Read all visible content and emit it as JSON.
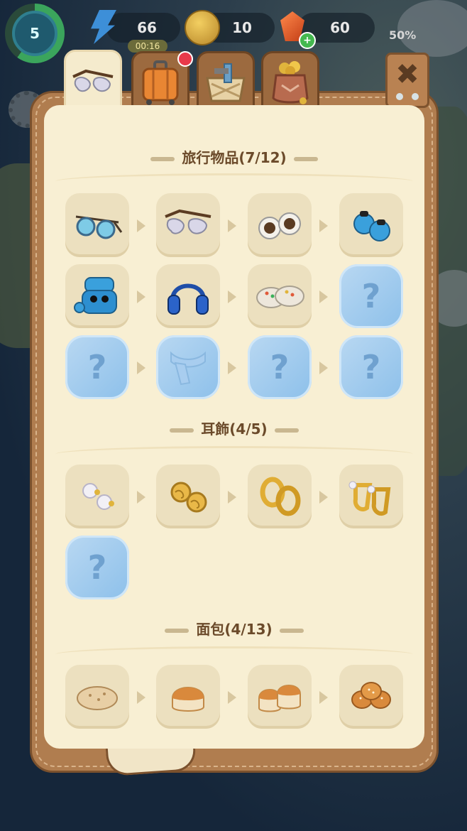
{
  "hud": {
    "level": "5",
    "energy": "66",
    "energy_timer": "00:16",
    "coins": "10",
    "gems": "60",
    "gem_plus": "+",
    "percent": "50%"
  },
  "tabs": [
    {
      "name": "sunglasses-tab-icon",
      "active": true
    },
    {
      "name": "suitcase-tab-icon",
      "active": false,
      "badge": true
    },
    {
      "name": "toolbox-tab-icon",
      "active": false
    },
    {
      "name": "treasure-pot-tab-icon",
      "active": false
    }
  ],
  "close_label": "✖",
  "sections": [
    {
      "title": "旅行物品(7/12)",
      "items": [
        "blue-sunglasses-icon",
        "heart-sunglasses-icon",
        "white-goggles-icon",
        "blue-earbuds-icon",
        "earbuds-case-icon",
        "headphones-icon",
        "clogs-icon",
        "locked",
        "locked",
        "scarf-silhouette-locked",
        "locked",
        "locked"
      ]
    },
    {
      "title": "耳飾(4/5)",
      "items": [
        "pearl-earrings-icon",
        "knot-earrings-icon",
        "gold-hoop-earrings-icon",
        "pearl-hoop-earrings-icon",
        "locked"
      ]
    },
    {
      "title": "面包(4/13)",
      "items": [
        "flatbread-icon",
        "bread-roll-icon",
        "double-roll-icon",
        "braided-bread-icon"
      ]
    }
  ],
  "locked_mark": "?",
  "colors": {
    "panel_border": "#b07d4f",
    "panel_bg": "#f8efd3",
    "slot_bg": "#ece0bf",
    "locked_bg": "#a9cdef",
    "title_text": "#6b4a2a"
  }
}
